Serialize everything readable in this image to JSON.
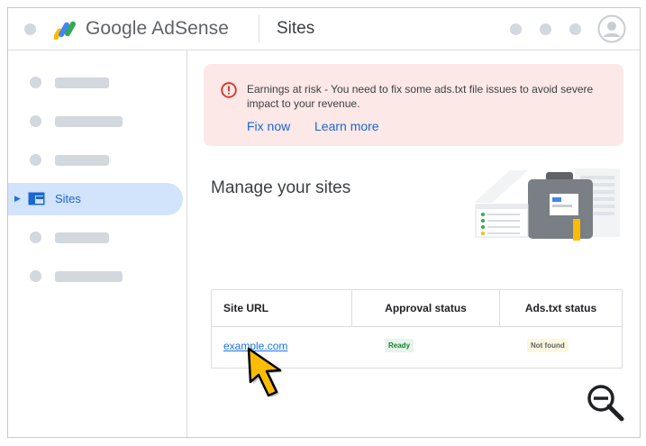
{
  "header": {
    "brand": "Google AdSense",
    "section": "Sites"
  },
  "sidebar": {
    "active_item": "Sites"
  },
  "alert": {
    "message": "Earnings at risk - You need to fix some ads.txt file issues to avoid severe impact to your revenue.",
    "fix_now": "Fix now",
    "learn_more": "Learn more"
  },
  "main": {
    "title": "Manage your sites"
  },
  "table": {
    "columns": [
      "Site URL",
      "Approval status",
      "Ads.txt status"
    ],
    "rows": [
      {
        "site_url": "example.com",
        "approval_status": "Ready",
        "ads_txt_status": "Not found"
      }
    ]
  },
  "colors": {
    "accent": "#1a73e8",
    "alert_bg": "#fce8e6",
    "alert_icon": "#d93025",
    "ready_bg": "#e6f4ea",
    "ready_text": "#188038",
    "notfound_bg": "#fef7e0",
    "notfound_text": "#5f6368",
    "cursor": "#fbbc04"
  }
}
